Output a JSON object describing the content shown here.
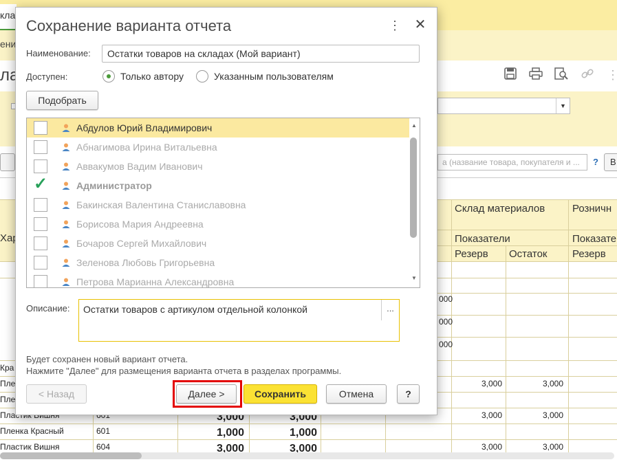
{
  "background": {
    "tab_fragment": "кла",
    "notice_fragment": "ени",
    "title_fragment": "ла",
    "search_placeholder_fragment": "а (название товара, покупателя и ...",
    "help_char": "?",
    "right_btn_fragment": "В",
    "header_left": "Хар",
    "header_warehouse": "Склад материалов",
    "header_retail": "Розничн",
    "header_indicators_1": "Показатели",
    "header_indicators_2": "Показате",
    "col_reserve_1": "Резерв",
    "col_remainder": "Остаток",
    "col_reserve_2": "Резерв",
    "side_values": [
      "000",
      "000",
      "000"
    ],
    "rows": [
      {
        "name": "Кра",
        "code": "",
        "v1": "",
        "v2": "",
        "r1": "",
        "r2": ""
      },
      {
        "name": "Плен",
        "code": "",
        "v1": "",
        "v2": "",
        "r1": "3,000",
        "r2": "3,000"
      },
      {
        "name": "Плен",
        "code": "",
        "v1": "",
        "v2": "",
        "r1": "",
        "r2": ""
      },
      {
        "name": "Пластик Вишня",
        "code": "601",
        "v1": "3,000",
        "v2": "3,000",
        "r1": "3,000",
        "r2": "3,000"
      },
      {
        "name": "Пленка Красный",
        "code": "601",
        "v1": "1,000",
        "v2": "1,000",
        "r1": "",
        "r2": ""
      },
      {
        "name": "Пластик Вишня",
        "code": "604",
        "v1": "3,000",
        "v2": "3,000",
        "r1": "3,000",
        "r2": "3,000"
      }
    ]
  },
  "dialog": {
    "title": "Сохранение варианта отчета",
    "more_icon": "⋮",
    "close_icon": "✕",
    "name_label": "Наименование:",
    "name_value": "Остатки товаров на складах (Мой вариант)",
    "available_label": "Доступен:",
    "radio_author": "Только автору",
    "radio_users": "Указанным пользователям",
    "radio_selected": "author",
    "pick_button": "Подобрать",
    "users": [
      {
        "name": "Абдулов Юрий Владимирович",
        "checked": false,
        "selected": true,
        "active": true
      },
      {
        "name": "Абнагимова Ирина Витальевна",
        "checked": false,
        "selected": false,
        "active": false
      },
      {
        "name": "Аввакумов Вадим Иванович",
        "checked": false,
        "selected": false,
        "active": false
      },
      {
        "name": "Администратор",
        "checked": true,
        "selected": false,
        "active": false,
        "admin": true
      },
      {
        "name": "Бакинская Валентина Станиславовна",
        "checked": false,
        "selected": false,
        "active": false
      },
      {
        "name": "Борисова Мария Андреевна",
        "checked": false,
        "selected": false,
        "active": false
      },
      {
        "name": "Бочаров Сергей Михайлович",
        "checked": false,
        "selected": false,
        "active": false
      },
      {
        "name": "Зеленова Любовь Григорьевна",
        "checked": false,
        "selected": false,
        "active": false
      },
      {
        "name": "Петрова Марианна Александровна",
        "checked": false,
        "selected": false,
        "active": false
      }
    ],
    "description_label": "Описание:",
    "description_value": "Остатки товаров с артикулом отдельной колонкой",
    "description_more": "...",
    "info_line1": "Будет сохранен новый вариант отчета.",
    "info_line2": "Нажмите \"Далее\" для размещения варианта отчета в разделах программы.",
    "back_button": "< Назад",
    "next_button": "Далее >",
    "save_button": "Сохранить",
    "cancel_button": "Отмена",
    "help_button": "?",
    "accent": "#fbe234",
    "highlight_color": "#e30000"
  }
}
